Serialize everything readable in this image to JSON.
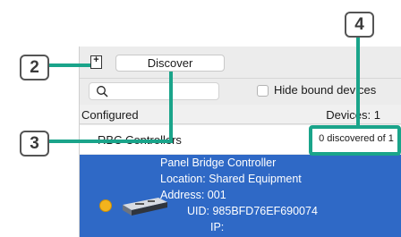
{
  "toolbar": {
    "add_icon_glyph": "+",
    "discover_label": "Discover"
  },
  "filter": {
    "search_icon": "search-icon",
    "hide_bound_label": "Hide bound devices"
  },
  "list_header": {
    "configured_label": "Configured",
    "devices_count_label": "Devices: 1"
  },
  "group": {
    "label": "RBC Controllers",
    "discovered_status": "0 discovered of 1"
  },
  "device": {
    "name": "Panel Bridge Controller",
    "location": "Location: Shared Equipment",
    "address": "Address: 001",
    "uid": "UID: 985BFD76EF690074",
    "ip": "IP:",
    "status_color": "#f2b31d"
  },
  "callouts": [
    "2",
    "3",
    "4"
  ],
  "colors": {
    "accent": "#1aa48a",
    "selection": "#2f69c6"
  }
}
